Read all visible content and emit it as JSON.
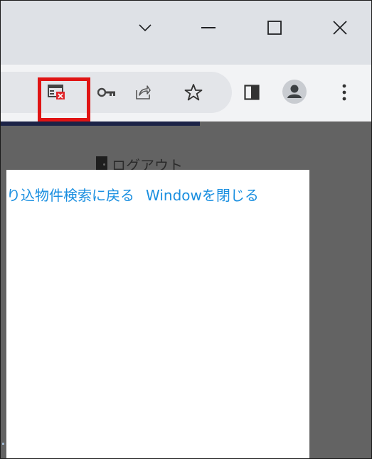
{
  "window_controls": {
    "tab_search_icon": "chevron-down-icon",
    "minimize_icon": "minimize-icon",
    "maximize_icon": "maximize-icon",
    "close_icon": "close-icon"
  },
  "toolbar": {
    "icons": [
      "popup-blocked-icon",
      "key-icon",
      "share-icon",
      "star-icon",
      "side-panel-icon",
      "profile-icon",
      "menu-icon"
    ]
  },
  "page": {
    "logout_label": "ログアウト",
    "links": {
      "back_label": "り込物件検索に戻る",
      "close_label": "Windowを閉じる"
    }
  },
  "colors": {
    "highlight": "#e01414",
    "link": "#1a8fe0",
    "page_background": "#636363",
    "navbar": "#1c2347"
  }
}
